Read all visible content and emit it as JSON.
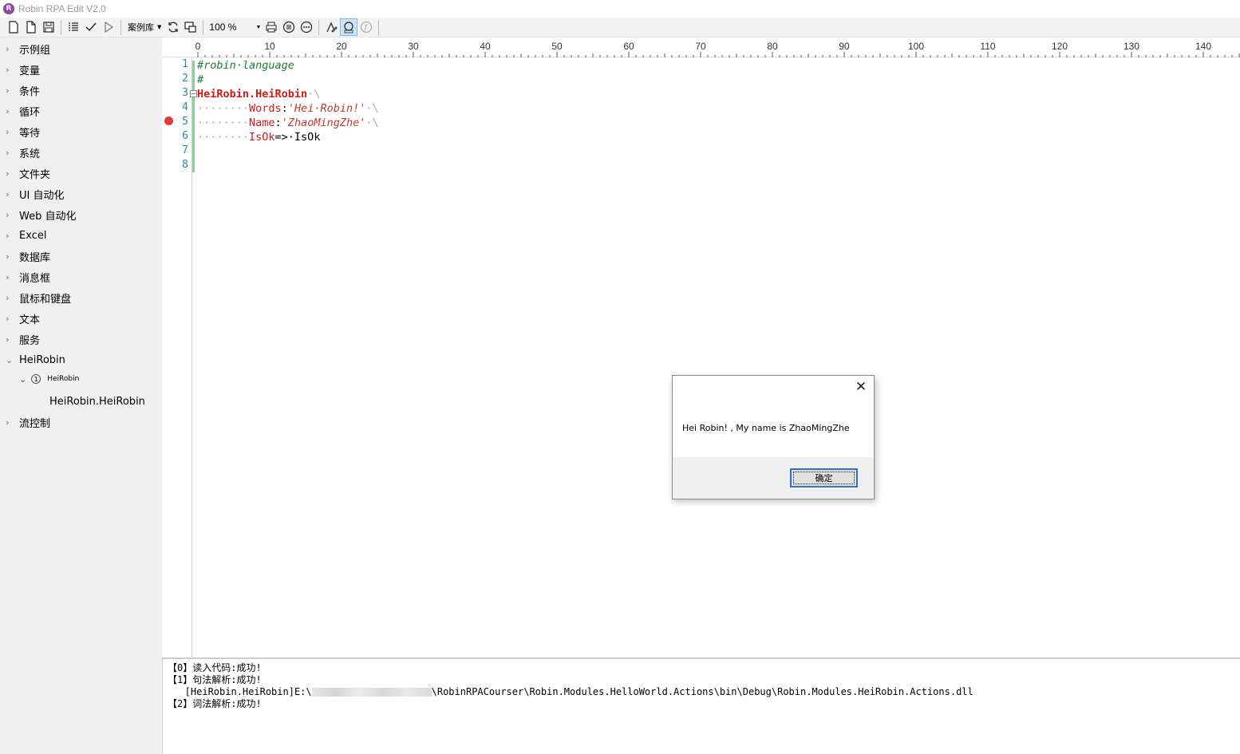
{
  "window": {
    "title": "Robin RPA Edit V2.0",
    "logo_letter": "R",
    "accent_color": "#8e44ad"
  },
  "toolbar": {
    "buttons_group1": [
      "new-file-icon",
      "new-page-icon",
      "save-icon"
    ],
    "buttons_group2": [
      "list-icon",
      "check-icon",
      "run-icon"
    ],
    "samples_label": "案例库",
    "buttons_group3": [
      "refresh-icon",
      "screen-capture-icon"
    ],
    "zoom_value": "100 %",
    "buttons_group4": [
      "print-icon",
      "align-icon",
      "more-icon"
    ],
    "buttons_group5": [
      "function-edit-icon",
      "face-id-icon",
      "formula-icon"
    ]
  },
  "sidebar": {
    "items": [
      "示例组",
      "变量",
      "条件",
      "循环",
      "等待",
      "系统",
      "文件夹",
      "UI 自动化",
      "Web 自动化",
      "Excel",
      "数据库",
      "消息框",
      "鼠标和键盘",
      "文本",
      "服务"
    ],
    "expanded_group": "HeiRobin",
    "sub_group_badge": "1",
    "sub_group": "HeiRobin",
    "leaf": "HeiRobin.HeiRobin",
    "last_item": "流控制"
  },
  "ruler": {
    "labels": [
      "0",
      "10",
      "20",
      "30",
      "40",
      "50",
      "60",
      "70",
      "80",
      "90",
      "100",
      "110",
      "120",
      "130",
      "140"
    ]
  },
  "editor": {
    "line_numbers": [
      "1",
      "2",
      "3",
      "4",
      "5",
      "6",
      "7",
      "8"
    ],
    "breakpoint_line": 5,
    "fold_glyph": "−",
    "line1": "#robin·language",
    "line2": "#",
    "line3_kw": "HeiRobin.HeiRobin",
    "line3_rest": "·\\",
    "line4_ws": "········",
    "line4_prop": "Words",
    "line4_colon": ":",
    "line4_str": "'Hei·Robin!'",
    "line4_rest": "·\\",
    "line5_ws": "········",
    "line5_prop": "Name",
    "line5_colon": ":",
    "line5_str": "'ZhaoMingZhe'",
    "line5_rest": "·\\",
    "line6_ws": "········",
    "line6_prop": "IsOk",
    "line6_rest": "=>·IsOk"
  },
  "output": {
    "line1": "【0】读入代码:成功!",
    "line2": "【1】句法解析:成功!",
    "line3_prefix": "   [HeiRobin.HeiRobin]E:\\",
    "line3_suffix": "\\RobinRPACourser\\Robin.Modules.HelloWorld.Actions\\bin\\Debug\\Robin.Modules.HeiRobin.Actions.dll",
    "line4": "【2】词法解析:成功!"
  },
  "dialog": {
    "close_glyph": "✕",
    "message": "Hei Robin! , My name is ZhaoMingZhe",
    "ok_label": "确定"
  }
}
